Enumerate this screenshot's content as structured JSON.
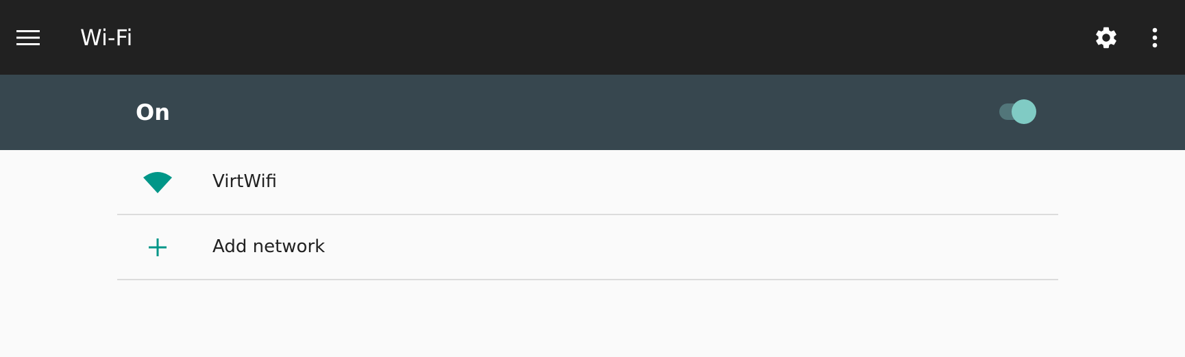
{
  "appbar": {
    "title": "Wi-Fi",
    "background": "#212121",
    "icons": {
      "menu": "menu-icon",
      "settings": "gear-icon",
      "overflow": "more-vert-icon"
    }
  },
  "master_switch": {
    "label": "On",
    "checked": true,
    "background": "#37474f",
    "accent": "#80cbc4"
  },
  "networks": [
    {
      "label": "VirtWifi",
      "icon": "wifi-signal-icon",
      "icon_color": "#009688"
    },
    {
      "label": "Add network",
      "icon": "plus-icon",
      "icon_color": "#009688"
    }
  ]
}
